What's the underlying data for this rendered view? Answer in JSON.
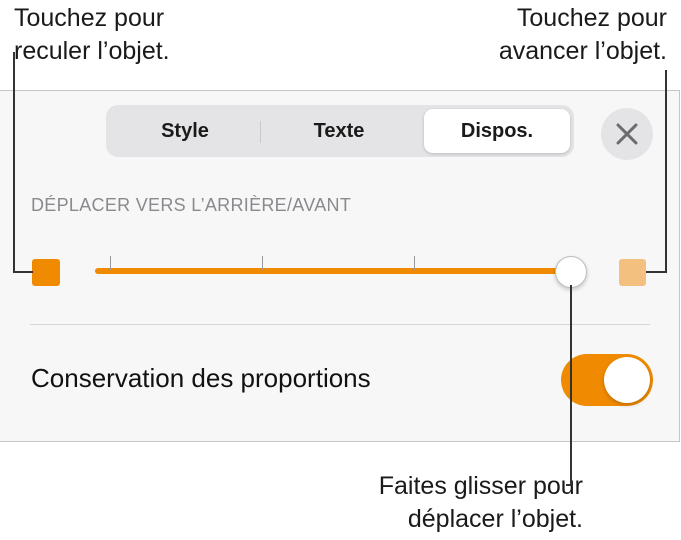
{
  "callouts": {
    "left": [
      "Touchez pour",
      "reculer l’objet."
    ],
    "right": [
      "Touchez pour",
      "avancer l’objet."
    ],
    "bottom": [
      "Faites glisser pour",
      "déplacer l’objet."
    ]
  },
  "tabs": {
    "style": "Style",
    "texte": "Texte",
    "dispos": "Dispos.",
    "selected": "Dispos."
  },
  "close_icon": "close-icon",
  "arrange": {
    "section_label": "DÉPLACER VERS L’ARRIÈRE/AVANT",
    "slider_value_fraction": 0.97,
    "backward_icon": "square-filled-icon",
    "forward_icon": "square-light-icon"
  },
  "proportions": {
    "label": "Conservation des proportions",
    "toggle_on": true
  },
  "colors": {
    "accent": "#F08A00",
    "accent_light": "#F3C07F"
  }
}
